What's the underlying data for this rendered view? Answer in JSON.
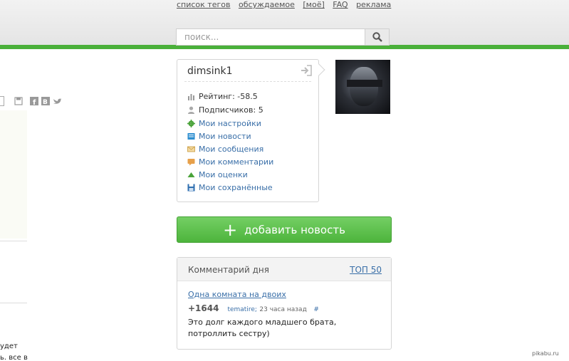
{
  "header": {
    "links": [
      "список тегов",
      "обсуждаемое",
      "[моё]",
      "FAQ",
      "реклама"
    ],
    "search_placeholder": "поиск..."
  },
  "left_column": {
    "cut_text": [
      "удет",
      "ь. все в"
    ]
  },
  "user": {
    "name": "dimsink1",
    "rating_label": "Рейтинг: -58.5",
    "subscribers_label": "Подписчиков: 5",
    "menu": [
      {
        "label": "Мои настройки",
        "icon": "gear-icon"
      },
      {
        "label": "Мои новости",
        "icon": "news-icon"
      },
      {
        "label": "Мои сообщения",
        "icon": "envelope-icon"
      },
      {
        "label": "Мои комментарии",
        "icon": "comment-icon"
      },
      {
        "label": "Мои оценки",
        "icon": "rating-arrow-icon"
      },
      {
        "label": "Мои сохранённые",
        "icon": "floppy-icon"
      }
    ]
  },
  "add_button": {
    "label": "добавить новость"
  },
  "comment_of_day": {
    "title": "Комментарий дня",
    "top_link": "ТОП 50",
    "post_link": "Одна комната на двоих",
    "score": "+1644",
    "author": "tematire;",
    "time": "23 часа назад",
    "hash": "#",
    "text": "Это долг каждого младшего брата, потроллить сестру)"
  },
  "watermark": "pikabu.ru",
  "colors": {
    "accent_green": "#4ab03a",
    "link_blue": "#3a6fa8"
  }
}
